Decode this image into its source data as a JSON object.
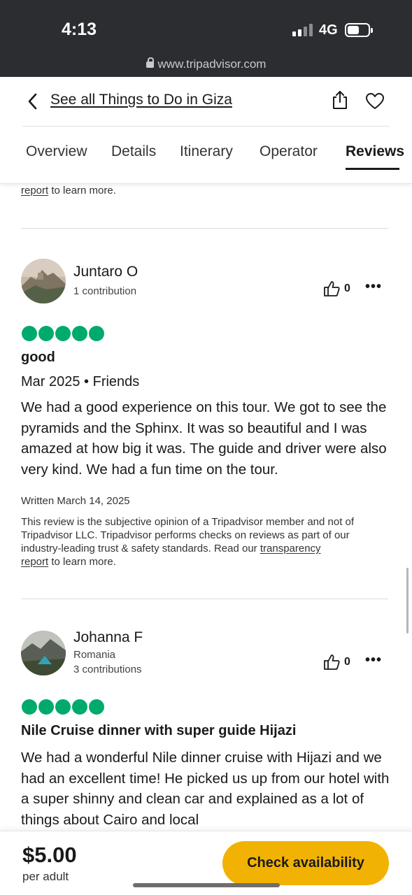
{
  "status_bar": {
    "time": "4:13",
    "network": "4G",
    "url": "www.tripadvisor.com"
  },
  "header": {
    "back_link": "See all Things to Do in Giza"
  },
  "tabs": [
    {
      "label": "Overview"
    },
    {
      "label": "Details"
    },
    {
      "label": "Itinerary"
    },
    {
      "label": "Operator"
    },
    {
      "label": "Reviews",
      "active": true
    }
  ],
  "previous_review_tail": {
    "link": "report",
    "text": " to learn more."
  },
  "reviews": [
    {
      "name": "Juntaro O",
      "location": "",
      "contributions": "1 contribution",
      "helpful_count": "0",
      "rating": 5,
      "title": "good",
      "date_line": "Mar 2025 • Friends",
      "body": "We had a good experience on this tour. We got to see the pyramids and the Sphinx. It was so beautiful and I was amazed at how big it was. The guide and driver were also very kind. We had a fun time on the tour.",
      "written": "Written March 14, 2025",
      "disclaimer_prefix": "This review is the subjective opinion of a Tripadvisor member and not of Tripadvisor LLC. Tripadvisor performs checks on reviews as part of our industry-leading trust & safety standards. Read our ",
      "disclaimer_link1": "transparency",
      "disclaimer_link2": "report",
      "disclaimer_suffix": " to learn more."
    },
    {
      "name": "Johanna F",
      "location": "Romania",
      "contributions": "3 contributions",
      "helpful_count": "0",
      "rating": 5,
      "title": "Nile Cruise dinner with super guide Hijazi",
      "body": "We had a wonderful Nile dinner cruise with Hijazi and we had an excellent time! He picked us up from our hotel with a super shinny and clean car and explained as a lot of things about Cairo and local"
    }
  ],
  "footer": {
    "price": "$5.00",
    "per": "per adult",
    "cta": "Check availability"
  },
  "colors": {
    "rating_green": "#00aa6c",
    "cta_yellow": "#f2b203",
    "status_bar": "#2b2d31"
  }
}
